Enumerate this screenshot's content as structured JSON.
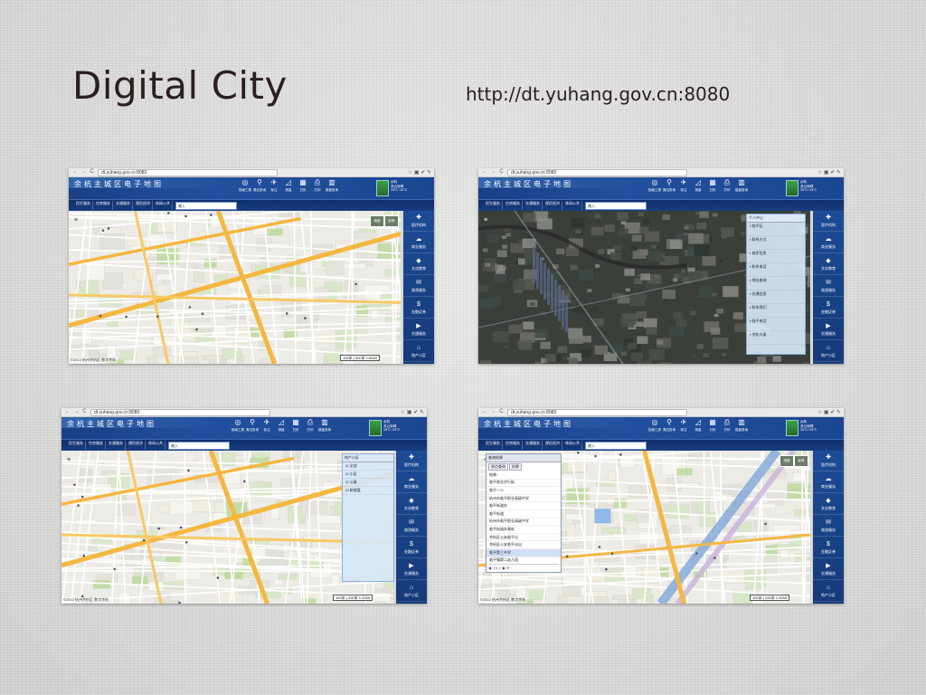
{
  "slide": {
    "title": "Digital City",
    "url": "http://dt.yuhang.gov.cn:8080"
  },
  "browser": {
    "address": "dt.yuhang.gov.cn:8080",
    "nav_glyphs": "← → C",
    "tool_glyphs": "☆ ▣ ✔ ✎"
  },
  "app": {
    "site_title": "余杭主城区电子地图",
    "nav_buttons": [
      "民生服务",
      "住房服务",
      "交通服务",
      "便民经济",
      "休闲公共"
    ],
    "search_placeholder": "输入",
    "tools": [
      {
        "icon": "compass-icon",
        "glyph": "◎",
        "label": "指南工具"
      },
      {
        "icon": "location-icon",
        "glyph": "⚲",
        "label": "周边查询"
      },
      {
        "icon": "pin-icon",
        "glyph": "✈",
        "label": "标注"
      },
      {
        "icon": "measure-icon",
        "glyph": "◿",
        "label": "测量"
      },
      {
        "icon": "calendar-icon",
        "glyph": "▦",
        "label": "日历"
      },
      {
        "icon": "print-icon",
        "glyph": "⎙",
        "label": "打印"
      },
      {
        "icon": "building-icon",
        "glyph": "▥",
        "label": "楼盘查询"
      }
    ],
    "weather": [
      "余杭",
      "多云转晴",
      "15°C~23°C"
    ],
    "sidebar": [
      {
        "icon": "medical-icon",
        "glyph": "✚",
        "label": "医疗机构"
      },
      {
        "icon": "business-icon",
        "glyph": "☁",
        "label": "商业服务"
      },
      {
        "icon": "culture-icon",
        "glyph": "◆",
        "label": "文化教育"
      },
      {
        "icon": "tourism-icon",
        "glyph": "✉",
        "label": "旅游服务"
      },
      {
        "icon": "finance-icon",
        "glyph": "$",
        "label": "金融证券"
      },
      {
        "icon": "transport-icon",
        "glyph": "▶",
        "label": "交通服务"
      },
      {
        "icon": "home-icon",
        "glyph": "⌂",
        "label": "地产小区"
      }
    ],
    "footer": "©2012 杭州余杭区 数字余杭",
    "layer_toggles": [
      "地图",
      "影像"
    ]
  },
  "screens": [
    {
      "scale": "1:8530",
      "scale_label": "100米 | 500米"
    },
    {
      "scale": "",
      "scale_label": ""
    },
    {
      "scale": "1:4265",
      "scale_label": "100米 | 200米"
    },
    {
      "scale": "1:4265",
      "scale_label": "100米 | 200米"
    }
  ],
  "satellite_panel": {
    "header": "个人中心",
    "rows": [
      "临平区",
      "联系方式",
      "商家信息",
      "联系电话",
      "地址查询",
      "交通信息",
      "联系我们",
      "临平电话",
      "余杭大厦"
    ]
  },
  "property_panel": {
    "header": "地产小区",
    "rows": [
      "全部",
      "小区",
      "公寓",
      "新楼盘"
    ]
  },
  "popup": {
    "header": "查询结果",
    "tabs": [
      "热点查询",
      "结果"
    ],
    "rows": [
      "结果:",
      "临平商业步行街",
      "临平一小",
      "杭州市临平职业高级中学",
      "临平街道办",
      "临平街道",
      "杭州市临平职业高级中学",
      "临平街道办事处",
      "余杭区公安临平分",
      "余杭区公安临平派出",
      "临平第三中学",
      "临平镇第二幼儿园"
    ],
    "selected_index": 10,
    "pager": "◀ ◁ 1 ▷ ▶ ⟳"
  }
}
